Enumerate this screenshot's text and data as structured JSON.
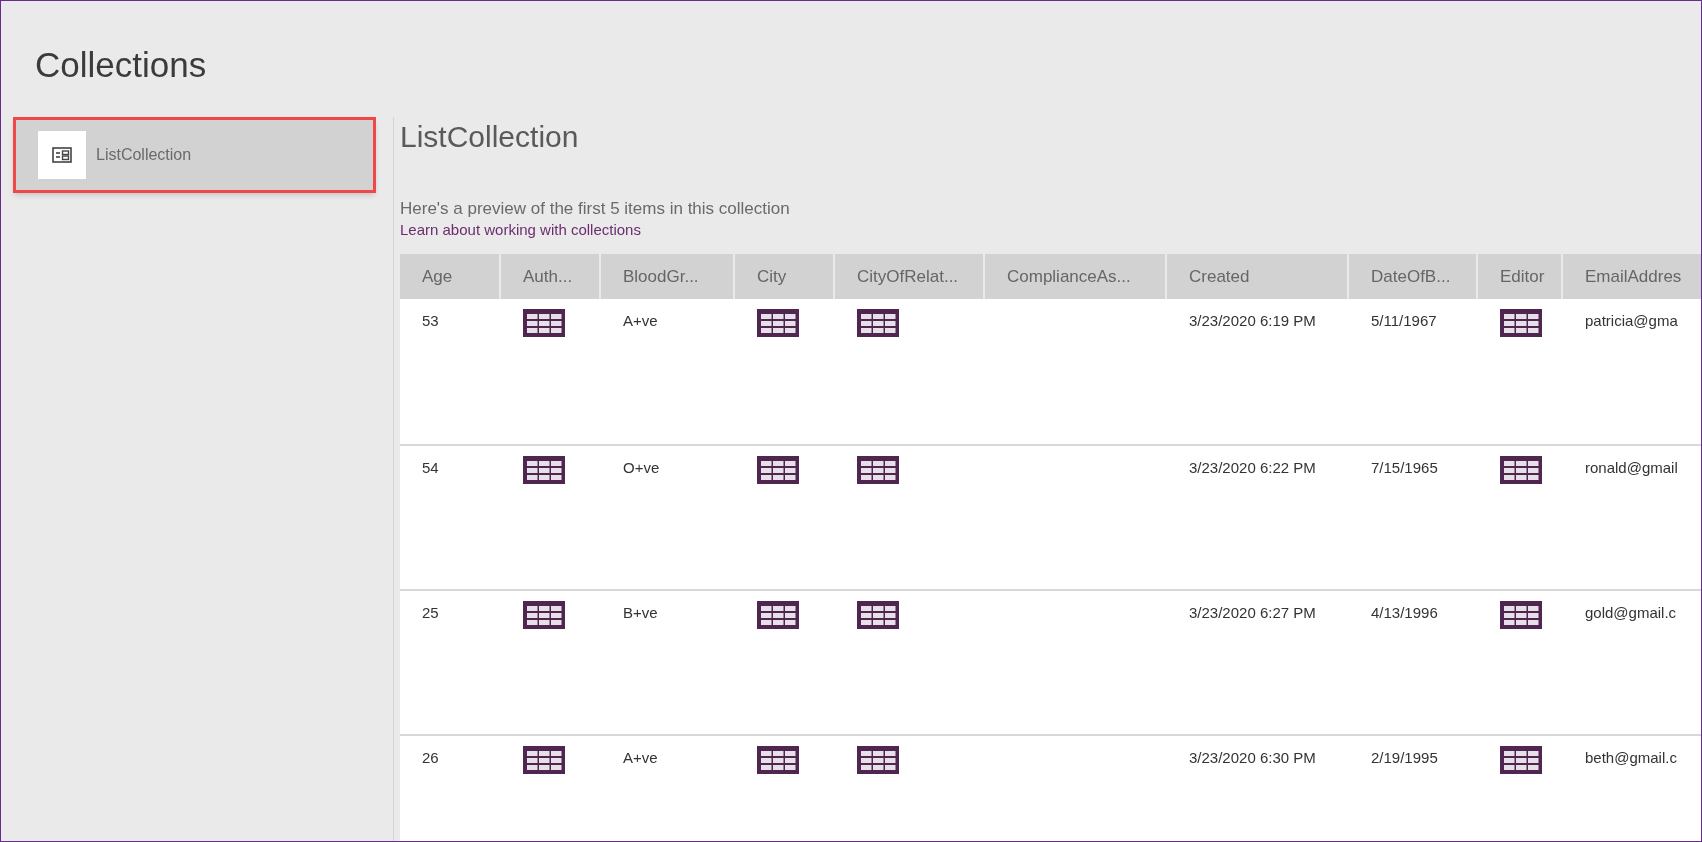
{
  "page_title": "Collections",
  "sidebar": {
    "items": [
      {
        "label": "ListCollection",
        "selected": true
      }
    ]
  },
  "detail": {
    "title": "ListCollection",
    "description": "Here's a preview of the first 5 items in this collection",
    "link": "Learn about working with collections"
  },
  "table": {
    "columns": [
      "Age",
      "Auth...",
      "BloodGr...",
      "City",
      "CityOfRelat...",
      "ComplianceAs...",
      "Created",
      "DateOfB...",
      "Editor",
      "EmailAddres"
    ],
    "rows": [
      [
        {
          "kind": "text",
          "text": "53"
        },
        {
          "kind": "table"
        },
        {
          "kind": "text",
          "text": "A+ve"
        },
        {
          "kind": "table"
        },
        {
          "kind": "table"
        },
        {
          "kind": "blank"
        },
        {
          "kind": "text",
          "text": "3/23/2020 6:19 PM"
        },
        {
          "kind": "text",
          "text": "5/11/1967"
        },
        {
          "kind": "table"
        },
        {
          "kind": "text",
          "text": "patricia@gma"
        }
      ],
      [
        {
          "kind": "text",
          "text": "54"
        },
        {
          "kind": "table"
        },
        {
          "kind": "text",
          "text": "O+ve"
        },
        {
          "kind": "table"
        },
        {
          "kind": "table"
        },
        {
          "kind": "blank"
        },
        {
          "kind": "text",
          "text": "3/23/2020 6:22 PM"
        },
        {
          "kind": "text",
          "text": "7/15/1965"
        },
        {
          "kind": "table"
        },
        {
          "kind": "text",
          "text": "ronald@gmail"
        }
      ],
      [
        {
          "kind": "text",
          "text": "25"
        },
        {
          "kind": "table"
        },
        {
          "kind": "text",
          "text": "B+ve"
        },
        {
          "kind": "table"
        },
        {
          "kind": "table"
        },
        {
          "kind": "blank"
        },
        {
          "kind": "text",
          "text": "3/23/2020 6:27 PM"
        },
        {
          "kind": "text",
          "text": "4/13/1996"
        },
        {
          "kind": "table"
        },
        {
          "kind": "text",
          "text": "gold@gmail.c"
        }
      ],
      [
        {
          "kind": "text",
          "text": "26"
        },
        {
          "kind": "table"
        },
        {
          "kind": "text",
          "text": "A+ve"
        },
        {
          "kind": "table"
        },
        {
          "kind": "table"
        },
        {
          "kind": "blank"
        },
        {
          "kind": "text",
          "text": "3/23/2020 6:30 PM"
        },
        {
          "kind": "text",
          "text": "2/19/1995"
        },
        {
          "kind": "table"
        },
        {
          "kind": "text",
          "text": "beth@gmail.c"
        }
      ]
    ]
  }
}
